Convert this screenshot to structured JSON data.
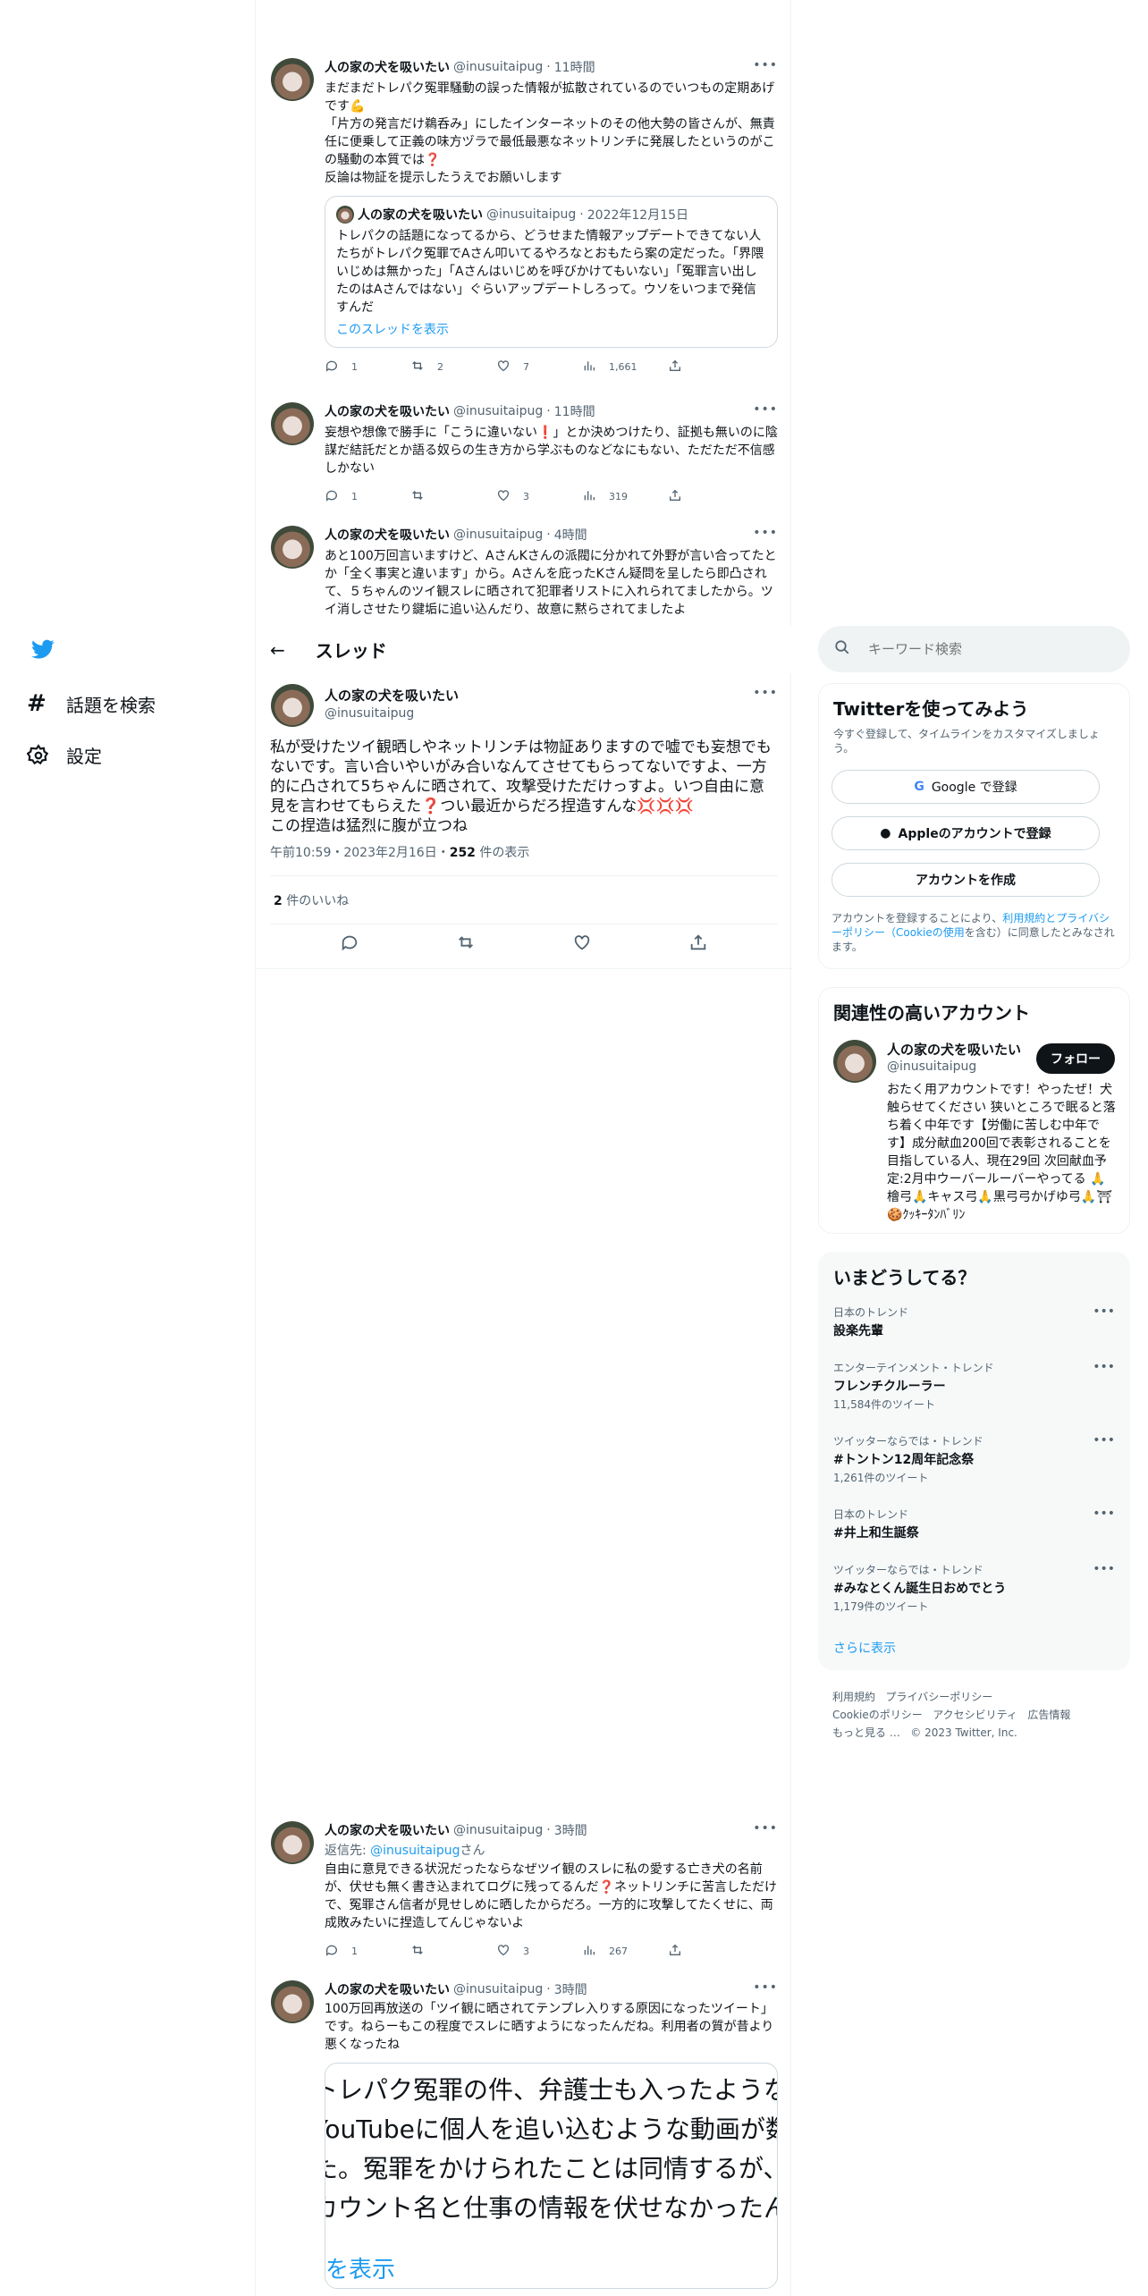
{
  "nav": {
    "settings_label": "設定",
    "explore_label": "話題を検索"
  },
  "author": {
    "name": "人の家の犬を吸いたい",
    "handle": "@inusuitaipug"
  },
  "tweets_above": [
    {
      "time": "11時間",
      "text": "まだまだトレパク冤罪騒動の誤った情報が拡散されているのでいつもの定期あげです💪\n「片方の発言だけ鵜呑み」にしたインターネットのその他大勢の皆さんが、無責任に便乗して正義の味方ヅラで最低最悪なネットリンチに発展したというのがこの騒動の本質では❓\n反論は物証を提示したうえでお願いします",
      "quote": {
        "name": "人の家の犬を吸いたい",
        "handle": "@inusuitaipug",
        "date": "2022年12月15日",
        "text": "トレパクの話題になってるから、どうせまた情報アップデートできてない人たちがトレパク冤罪でAさん叩いてるやろなとおもたら案の定だった。「界隈いじめは無かった」「Aさんはいじめを呼びかけてもいない」「冤罪言い出したのはAさんではない」ぐらいアップデートしろって。ウソをいつまで発信すんだ",
        "show_thread": "このスレッドを表示"
      },
      "reply": "1",
      "retweet": "2",
      "like": "7",
      "views": "1,661"
    },
    {
      "time": "11時間",
      "text": "妄想や想像で勝手に「こうに違いない❗️」とか決めつけたり、証拠も無いのに陰謀だ結託だとか語る奴らの生き方から学ぶものなどなにもない、ただただ不信感しかない",
      "reply": "1",
      "retweet": "",
      "like": "3",
      "views": "319"
    },
    {
      "time": "4時間",
      "text": "あと100万回言いますけど、AさんKさんの派閥に分かれて外野が言い合ってたとか「全く事実と違います」から。Aさんを庇ったKさん疑問を呈したら即凸されて、５ちゃんのツイ観スレに晒されて犯罪者リストに入れられてましたから。ツイ消しさせたり鍵垢に追い込んだり、故意に黙らされてましたよ"
    }
  ],
  "thread_header": {
    "title": "スレッド"
  },
  "main_tweet": {
    "text": "私が受けたツイ観晒しやネットリンチは物証ありますので嘘でも妄想でもないです。言い合いやいがみ合いなんてさせてもらってないですよ、一方的に凸されて5ちゃんに晒されて、攻撃受けただけっすよ。いつ自由に意見を言わせてもらえた❓つい最近からだろ捏造すんな💢💢💢\nこの捏造は猛烈に腹が立つね",
    "timestamp": "午前10:59・2023年2月16日・",
    "views_count": "252",
    "views_label": " 件の表示",
    "likes_count": "2",
    "likes_label": " 件のいいね"
  },
  "tweets_below": [
    {
      "time": "3時間",
      "reply_to_label": "返信先: ",
      "reply_to": "@inusuitaipug",
      "reply_to_suffix": "さん",
      "text": "自由に意見できる状況だったならなぜツイ観のスレに私の愛する亡き犬の名前が、伏せも無く書き込まれてログに残ってるんだ❓ネットリンチに苦言しただけで、冤罪さん信者が見せしめに晒したからだろ。一方的に攻撃してたくせに、両成敗みたいに捏造してんじゃないよ",
      "reply": "1",
      "retweet": "",
      "like": "3",
      "views": "267"
    },
    {
      "time": "3時間",
      "text": "100万回再放送の「ツイ観に晒されてテンプレ入りする原因になったツイート」です。ねらーもこの程度でスレに晒すようになったんだね。利用者の質が昔より悪くなったね",
      "card_lines": [
        "トレパク冤罪の件、弁護士も入ったようなの",
        "YouTubeに個人を追い込むような動画が数",
        "た。冤罪をかけられたことは同情するが、n",
        "カウント名と仕事の情報を伏せなかったんだ。"
      ],
      "card_link": "を表示"
    }
  ],
  "search": {
    "placeholder": "キーワード検索"
  },
  "signup": {
    "title": "Twitterを使ってみよう",
    "desc": "今すぐ登録して、タイムラインをカスタマイズしましょう。",
    "google": "Google で登録",
    "apple": "Appleのアカウントで登録",
    "create": "アカウントを作成",
    "legal_pre": "アカウントを登録することにより、",
    "legal_link": "利用規約とプライバシーポリシー（Cookieの使用",
    "legal_post": "を含む）に同意したとみなされます。"
  },
  "relevant": {
    "title": "関連性の高いアカウント",
    "follow": "フォロー",
    "bio": "おたく用アカウントです！やったぜ！犬触らせてください 狭いところで眠ると落ち着く中年です【労働に苦しむ中年です】成分献血200回で表彰されることを目指している人、現在29回 次回献血予定:2月中ウーバールーバーやってる 🙏檜弓🙏キャス弓🙏黒弓弓かげゆ弓🙏⛩🍪ｸｯｷｰﾀﾝﾊﾞﾘﾝ"
  },
  "trends": {
    "title": "いまどうしてる？",
    "items": [
      {
        "meta": "日本のトレンド",
        "name": "設楽先輩",
        "count": ""
      },
      {
        "meta": "エンターテインメント・トレンド",
        "name": "フレンチクルーラー",
        "count": "11,584件のツイート"
      },
      {
        "meta": "ツイッターならでは・トレンド",
        "name": "#トントン12周年記念祭",
        "count": "1,261件のツイート"
      },
      {
        "meta": "日本のトレンド",
        "name": "#井上和生誕祭",
        "count": ""
      },
      {
        "meta": "ツイッターならでは・トレンド",
        "name": "#みなとくん誕生日おめでとう",
        "count": "1,179件のツイート"
      }
    ],
    "more": "さらに表示"
  },
  "footer": {
    "terms": "利用規約",
    "privacy": "プライバシーポリシー",
    "cookie": "Cookieのポリシー",
    "access": "アクセシビリティ",
    "ads": "広告情報",
    "more": "もっと見る …",
    "copy": "© 2023 Twitter, Inc."
  },
  "colors": {
    "accent": "#1d9bf0",
    "text": "#0f1419",
    "muted": "#536471",
    "border": "#eff3f4"
  }
}
